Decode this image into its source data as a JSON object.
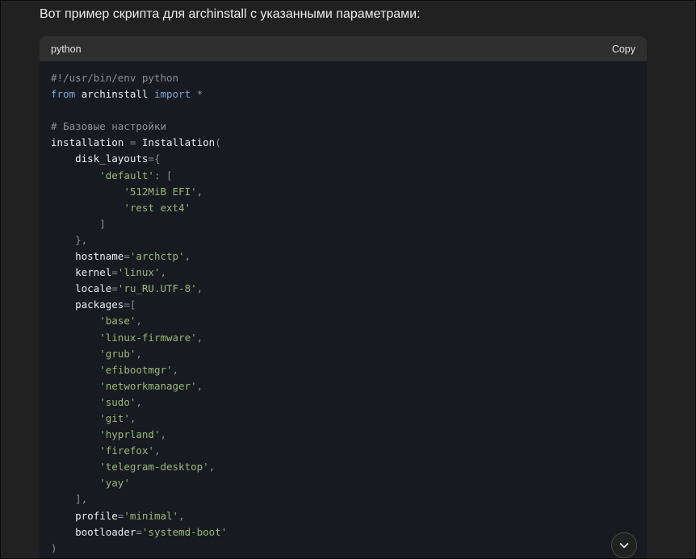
{
  "message": {
    "intro_text": "Вот пример скрипта для archinstall с указанными параметрами:"
  },
  "code_block": {
    "language": "python",
    "copy_label": "Copy",
    "lines": [
      [
        {
          "t": "#!/usr/bin/env python",
          "k": "comment"
        }
      ],
      [
        {
          "t": "from",
          "k": "keyword"
        },
        {
          "t": " archinstall ",
          "k": "ident"
        },
        {
          "t": "import",
          "k": "keyword"
        },
        {
          "t": " *",
          "k": "punct"
        }
      ],
      [],
      [
        {
          "t": "# Базовые настройки",
          "k": "comment"
        }
      ],
      [
        {
          "t": "installation",
          "k": "ident"
        },
        {
          "t": " = ",
          "k": "punct"
        },
        {
          "t": "Installation",
          "k": "ident"
        },
        {
          "t": "(",
          "k": "punct"
        }
      ],
      [
        {
          "t": "    disk_layouts",
          "k": "ident"
        },
        {
          "t": "={",
          "k": "punct"
        }
      ],
      [
        {
          "t": "        ",
          "k": "ident"
        },
        {
          "t": "'default'",
          "k": "string"
        },
        {
          "t": ": [",
          "k": "punct"
        }
      ],
      [
        {
          "t": "            ",
          "k": "ident"
        },
        {
          "t": "'512MiB EFI'",
          "k": "string"
        },
        {
          "t": ",",
          "k": "punct"
        }
      ],
      [
        {
          "t": "            ",
          "k": "ident"
        },
        {
          "t": "'rest ext4'",
          "k": "string"
        }
      ],
      [
        {
          "t": "        ]",
          "k": "punct"
        }
      ],
      [
        {
          "t": "    },",
          "k": "punct"
        }
      ],
      [
        {
          "t": "    hostname",
          "k": "ident"
        },
        {
          "t": "=",
          "k": "punct"
        },
        {
          "t": "'archctp'",
          "k": "string"
        },
        {
          "t": ",",
          "k": "punct"
        }
      ],
      [
        {
          "t": "    kernel",
          "k": "ident"
        },
        {
          "t": "=",
          "k": "punct"
        },
        {
          "t": "'linux'",
          "k": "string"
        },
        {
          "t": ",",
          "k": "punct"
        }
      ],
      [
        {
          "t": "    locale",
          "k": "ident"
        },
        {
          "t": "=",
          "k": "punct"
        },
        {
          "t": "'ru_RU.UTF-8'",
          "k": "string"
        },
        {
          "t": ",",
          "k": "punct"
        }
      ],
      [
        {
          "t": "    packages",
          "k": "ident"
        },
        {
          "t": "=[",
          "k": "punct"
        }
      ],
      [
        {
          "t": "        ",
          "k": "ident"
        },
        {
          "t": "'base'",
          "k": "string"
        },
        {
          "t": ",",
          "k": "punct"
        }
      ],
      [
        {
          "t": "        ",
          "k": "ident"
        },
        {
          "t": "'linux-firmware'",
          "k": "string"
        },
        {
          "t": ",",
          "k": "punct"
        }
      ],
      [
        {
          "t": "        ",
          "k": "ident"
        },
        {
          "t": "'grub'",
          "k": "string"
        },
        {
          "t": ",",
          "k": "punct"
        }
      ],
      [
        {
          "t": "        ",
          "k": "ident"
        },
        {
          "t": "'efibootmgr'",
          "k": "string"
        },
        {
          "t": ",",
          "k": "punct"
        }
      ],
      [
        {
          "t": "        ",
          "k": "ident"
        },
        {
          "t": "'networkmanager'",
          "k": "string"
        },
        {
          "t": ",",
          "k": "punct"
        }
      ],
      [
        {
          "t": "        ",
          "k": "ident"
        },
        {
          "t": "'sudo'",
          "k": "string"
        },
        {
          "t": ",",
          "k": "punct"
        }
      ],
      [
        {
          "t": "        ",
          "k": "ident"
        },
        {
          "t": "'git'",
          "k": "string"
        },
        {
          "t": ",",
          "k": "punct"
        }
      ],
      [
        {
          "t": "        ",
          "k": "ident"
        },
        {
          "t": "'hyprland'",
          "k": "string"
        },
        {
          "t": ",",
          "k": "punct"
        }
      ],
      [
        {
          "t": "        ",
          "k": "ident"
        },
        {
          "t": "'firefox'",
          "k": "string"
        },
        {
          "t": ",",
          "k": "punct"
        }
      ],
      [
        {
          "t": "        ",
          "k": "ident"
        },
        {
          "t": "'telegram-desktop'",
          "k": "string"
        },
        {
          "t": ",",
          "k": "punct"
        }
      ],
      [
        {
          "t": "        ",
          "k": "ident"
        },
        {
          "t": "'yay'",
          "k": "string"
        }
      ],
      [
        {
          "t": "    ],",
          "k": "punct"
        }
      ],
      [
        {
          "t": "    profile",
          "k": "ident"
        },
        {
          "t": "=",
          "k": "punct"
        },
        {
          "t": "'minimal'",
          "k": "string"
        },
        {
          "t": ",",
          "k": "punct"
        }
      ],
      [
        {
          "t": "    bootloader",
          "k": "ident"
        },
        {
          "t": "=",
          "k": "punct"
        },
        {
          "t": "'systemd-boot'",
          "k": "string"
        }
      ],
      [
        {
          "t": ")",
          "k": "punct"
        }
      ]
    ]
  },
  "icons": {
    "scroll_down": "chevron-down-icon"
  },
  "colors": {
    "page_bg": "#212121",
    "code_bg": "#171a20",
    "header_bg": "#2f2f2f",
    "keyword": "#7aa6d8",
    "string": "#98b87a",
    "comment": "#8b8f96"
  }
}
